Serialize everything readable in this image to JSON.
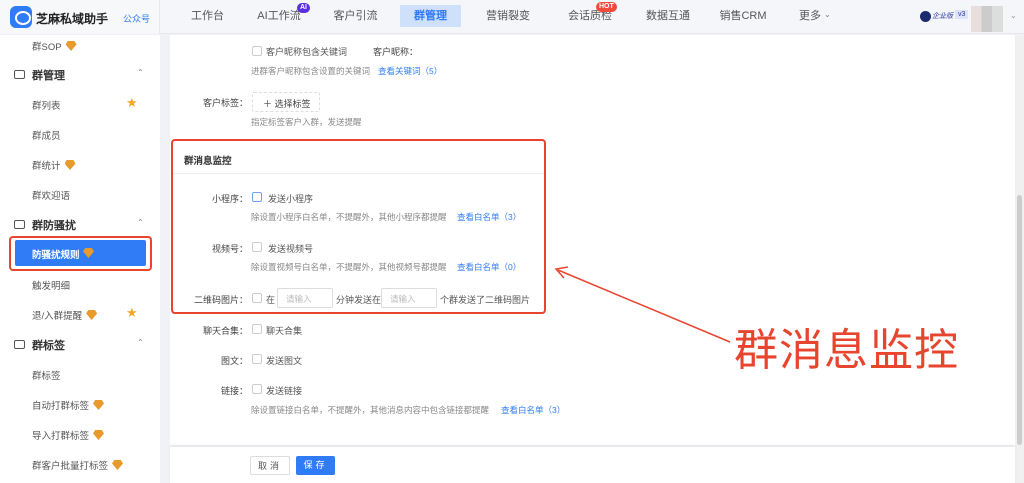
{
  "header": {
    "brand": "芝麻私域助手",
    "account_link": "公众号",
    "nav": [
      {
        "label": "工作台"
      },
      {
        "label": "AI工作流",
        "badge": "AI"
      },
      {
        "label": "客户引流"
      },
      {
        "label": "群管理"
      },
      {
        "label": "营销裂变"
      },
      {
        "label": "会话质检",
        "badge": "HOT"
      },
      {
        "label": "数据互通"
      },
      {
        "label": "销售CRM"
      },
      {
        "label": "更多"
      }
    ],
    "edition": "企业版",
    "version": "v3"
  },
  "sidebar": {
    "items": [
      {
        "label": "群SOP"
      },
      {
        "label": "群管理"
      },
      {
        "label": "群列表"
      },
      {
        "label": "群成员"
      },
      {
        "label": "群统计"
      },
      {
        "label": "群欢迎语"
      },
      {
        "label": "群防骚扰"
      },
      {
        "label": "防骚扰规则"
      },
      {
        "label": "触发明细"
      },
      {
        "label": "退/入群提醒"
      },
      {
        "label": "群标签"
      },
      {
        "label": "群标签"
      },
      {
        "label": "自动打群标签"
      },
      {
        "label": "导入打群标签"
      },
      {
        "label": "群客户批量打标签"
      }
    ]
  },
  "form": {
    "nickname": {
      "label": "客户昵称：",
      "option": "客户昵称包含关键词",
      "hint": "进群客户昵称包含设置的关键词",
      "link": "查看关键词（5）"
    },
    "tags": {
      "label": "客户标签：",
      "button": "选择标签",
      "hint": "指定标签客户入群，发送提醒"
    },
    "section_title": "群消息监控",
    "miniprogram": {
      "label": "小程序：",
      "option": "发送小程序",
      "hint": "除设置小程序白名单，不提醒外，其他小程序都提醒",
      "link": "查看白名单（3）"
    },
    "channels": {
      "label": "视频号：",
      "option": "发送视频号",
      "hint": "除设置视频号白名单，不提醒外，其他视频号都提醒",
      "link": "查看白名单（0）"
    },
    "qrcode": {
      "label": "二维码图片：",
      "prefix": "在",
      "placeholder1": "请输入",
      "middle": "分钟发送在",
      "placeholder2": "请输入",
      "suffix": "个群发送了二维码图片"
    },
    "chat": {
      "label": "聊天合集：",
      "option": "聊天合集"
    },
    "article": {
      "label": "图文：",
      "option": "发送图文"
    },
    "links": {
      "label": "链接：",
      "option": "发送链接",
      "hint": "除设置链接白名单，不提醒外，其他消息内容中包含链接都提醒",
      "link": "查看白名单（3）"
    }
  },
  "footer": {
    "cancel": "取消",
    "save": "保存"
  },
  "annotation": {
    "text": "群消息监控",
    "color": "#e8452f"
  }
}
